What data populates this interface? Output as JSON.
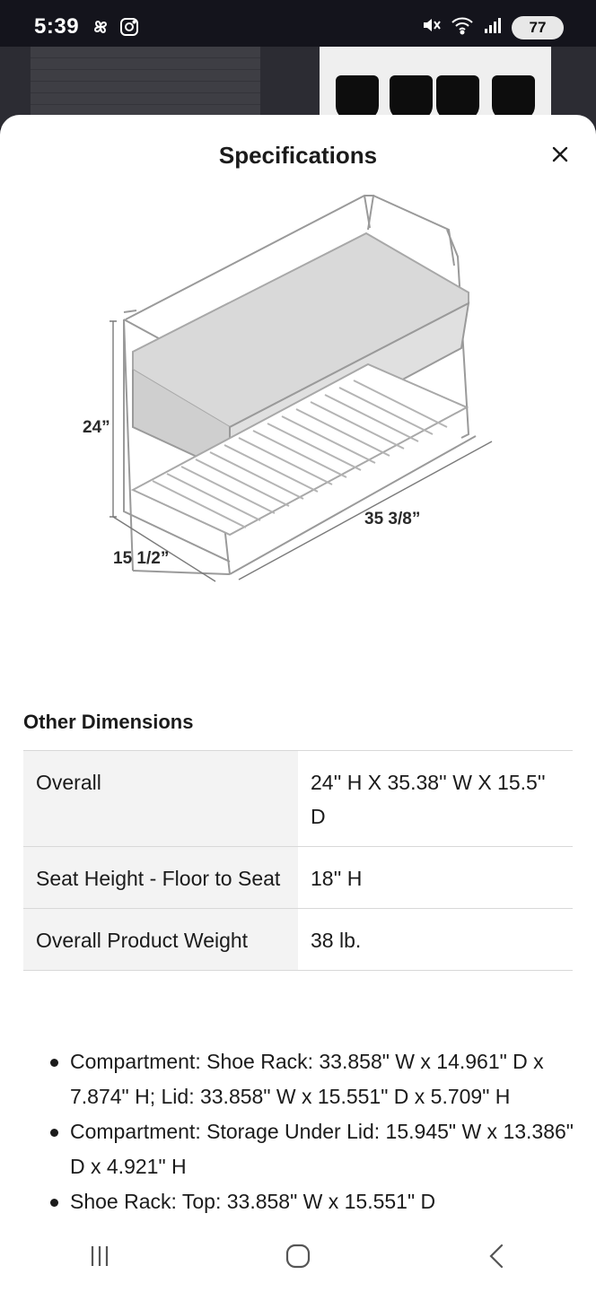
{
  "status_bar": {
    "time": "5:39",
    "battery": "77",
    "icons": [
      "pinwheel-icon",
      "instagram-icon",
      "mute-icon",
      "wifi-icon",
      "signal-icon",
      "battery-icon"
    ]
  },
  "sheet": {
    "title": "Specifications",
    "close_icon": "close-icon"
  },
  "diagram": {
    "height_label": "24”",
    "width_label": "35 3/8”",
    "depth_label": "15 1/2”"
  },
  "other_dimensions": {
    "title": "Other Dimensions",
    "rows": [
      {
        "label": "Overall",
        "value": "24'' H X 35.38'' W X 15.5'' D"
      },
      {
        "label": "Seat Height - Floor to Seat",
        "value": "18'' H"
      },
      {
        "label": "Overall Product Weight",
        "value": "38 lb."
      }
    ]
  },
  "bullets": [
    "Compartment: Shoe Rack: 33.858\" W x 14.961\" D x 7.874\" H; Lid: 33.858\" W x 15.551\" D x 5.709\" H",
    "Compartment: Storage Under Lid: 15.945\" W x 13.386\" D x 4.921\" H",
    "Shoe Rack: Top: 33.858\" W x 15.551\" D"
  ],
  "nav_bar": {
    "icons": [
      "recent-apps-icon",
      "home-icon",
      "back-icon"
    ]
  },
  "colors": {
    "status_bg": "#14141c",
    "sheet_bg": "#ffffff",
    "label_cell_bg": "#f3f3f3",
    "divider": "#d8d8d8",
    "text": "#1b1b1b"
  }
}
